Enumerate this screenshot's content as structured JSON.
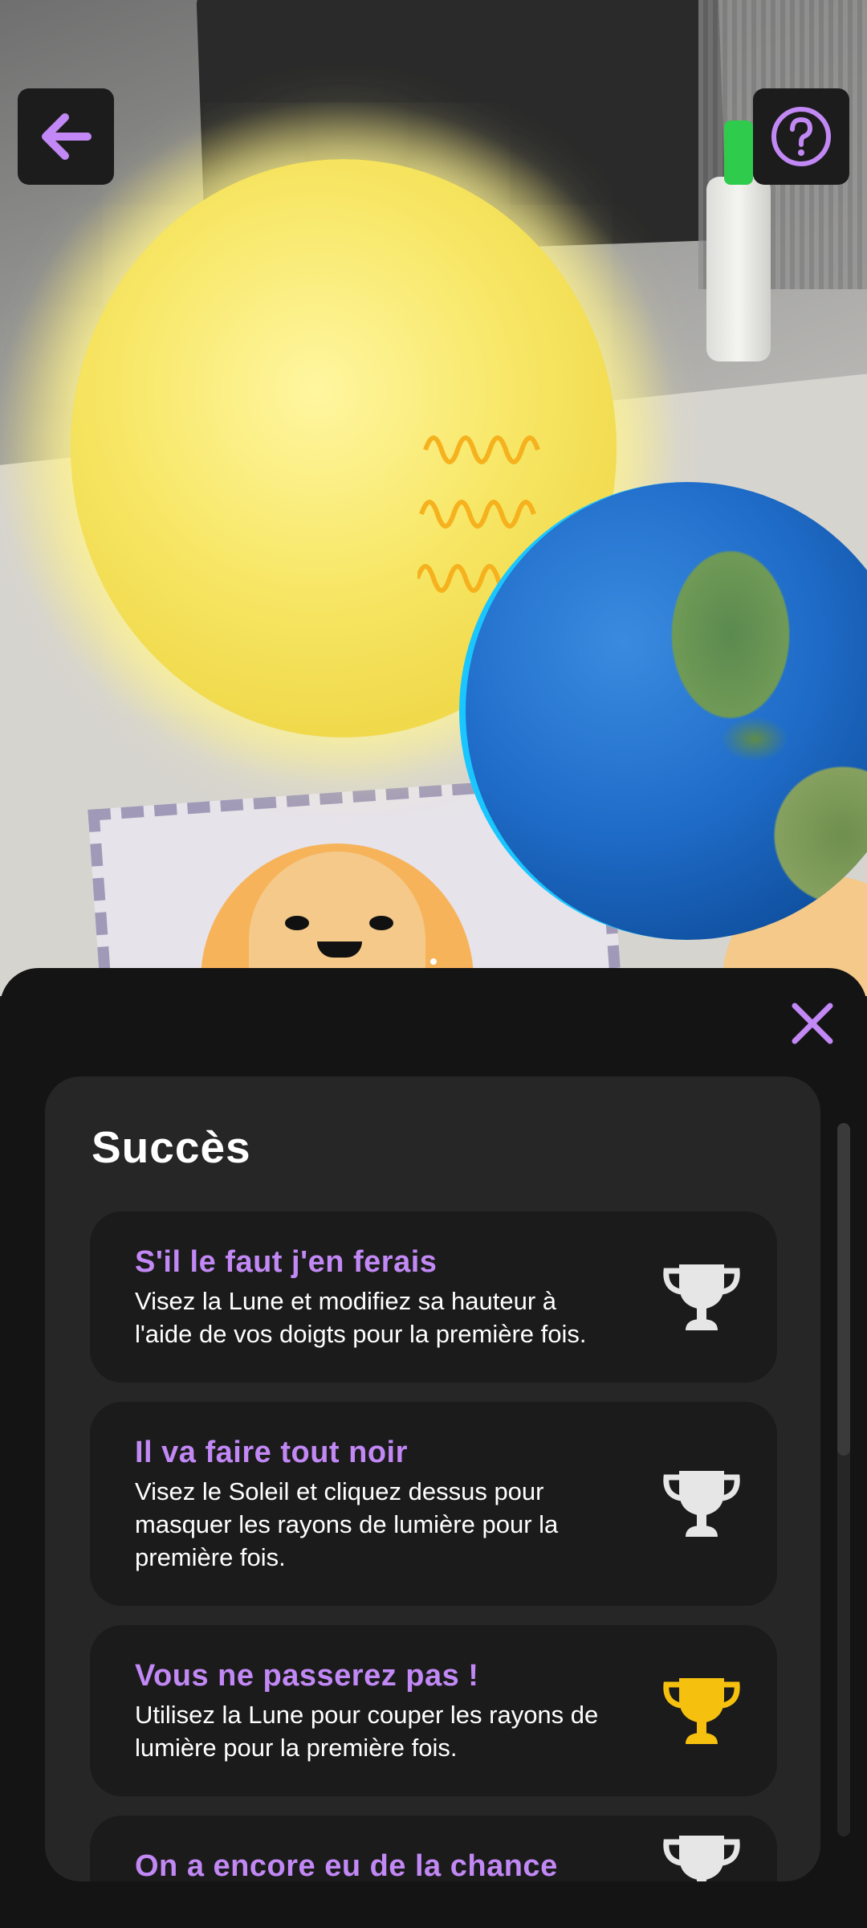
{
  "colors": {
    "accent": "#c288f5",
    "panel": "#262626",
    "sheet": "#141414",
    "trophy_locked": "#e6e6e6",
    "trophy_unlocked": "#f6c10e"
  },
  "icons": {
    "back": "arrow-left-icon",
    "help": "question-circle-icon",
    "close": "close-icon",
    "trophy": "trophy-icon"
  },
  "achievements": {
    "title": "Succès",
    "items": [
      {
        "title": "S'il le faut j'en ferais",
        "description": "Visez la Lune et modifiez sa hauteur à l'aide de vos doigts pour la première fois.",
        "unlocked": false
      },
      {
        "title": "Il va faire tout noir",
        "description": "Visez le Soleil et cliquez dessus pour masquer les rayons de lumière pour la première fois.",
        "unlocked": false
      },
      {
        "title": "Vous ne passerez pas !",
        "description": "Utilisez la Lune pour couper les rayons de lumière pour la première fois.",
        "unlocked": true
      },
      {
        "title": "On a encore eu de la chance",
        "description": "",
        "unlocked": false
      }
    ]
  }
}
